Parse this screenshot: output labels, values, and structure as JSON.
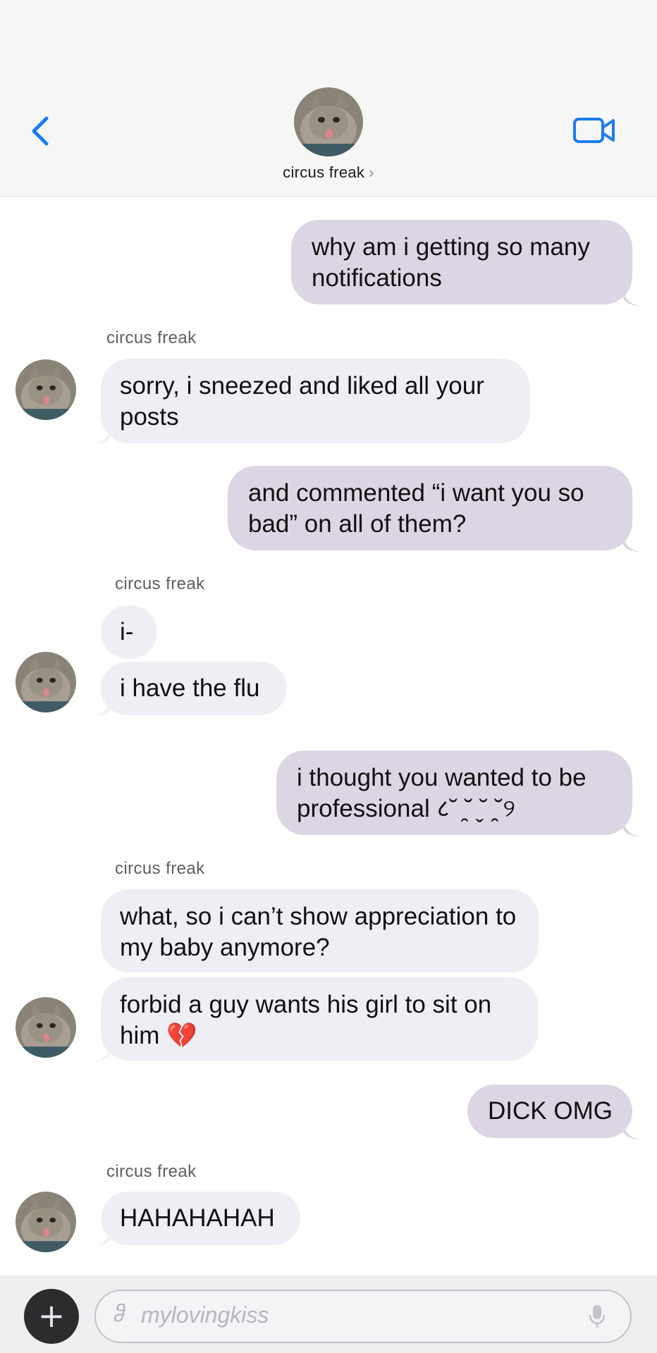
{
  "header": {
    "contact_name": "circus freak",
    "chevron": "›",
    "back_icon": "chevron-left-icon",
    "video_icon": "video-camera-icon"
  },
  "messages": [
    {
      "from": "me",
      "text": "why am i getting so many notifications"
    },
    {
      "from": "them",
      "sender": "circus freak",
      "text": "sorry, i sneezed and liked all your posts"
    },
    {
      "from": "me",
      "text": "and commented “i want you so bad” on all of them?"
    },
    {
      "from": "them",
      "sender": "circus freak",
      "text": "i-"
    },
    {
      "from": "them",
      "text": "i have the flu"
    },
    {
      "from": "me",
      "text": "i thought you wanted to be professional ८˘ ̯˘ ̬˘ ̯˘୨"
    },
    {
      "from": "them",
      "sender": "circus freak",
      "text": "what, so i can’t show appreciation to my baby anymore?"
    },
    {
      "from": "them",
      "text": "forbid a guy wants his girl to sit on him 💔"
    },
    {
      "from": "me",
      "text": "DICK OMG"
    },
    {
      "from": "them",
      "sender": "circus freak",
      "text": "HAHAHAHAH"
    }
  ],
  "sender_labels": {
    "l1": "circus freak",
    "l2": "circus freak",
    "l3": "circus freak",
    "l4": "circus freak"
  },
  "composer": {
    "plus_label": "+",
    "prefix": "ჵ",
    "placeholder": "mylovingkiss",
    "mic_icon": "microphone-icon"
  },
  "colors": {
    "outgoing_bubble": "#dcd5e3",
    "incoming_bubble": "#efeef4",
    "accent": "#1a7cf2"
  }
}
